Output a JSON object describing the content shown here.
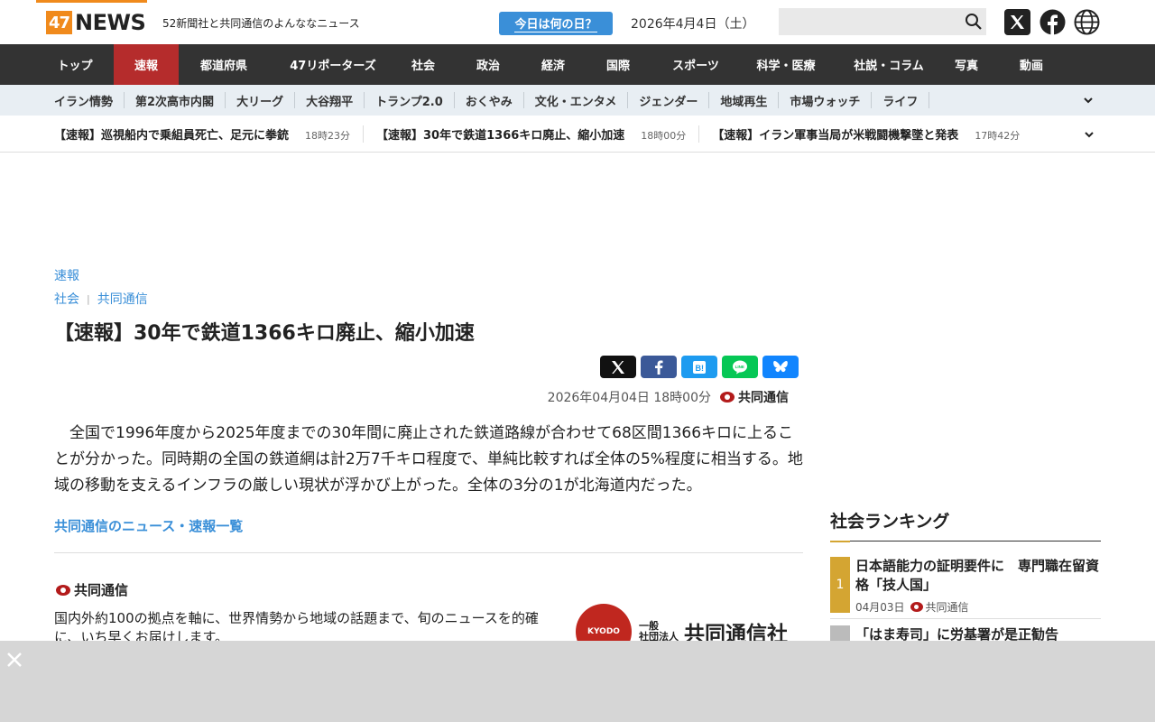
{
  "header": {
    "logo_num": "47",
    "logo_text": "NEWS",
    "tagline": "52新聞社と共同通信のよんななニュース",
    "today_button": "今日は何の日？",
    "date": "2026年4月4日（土）",
    "search_placeholder": ""
  },
  "nav": {
    "items": [
      "トップ",
      "速報",
      "都道府県",
      "47リポーターズ",
      "社会",
      "政治",
      "経済",
      "国際",
      "スポーツ",
      "科学・医療",
      "社説・コラム",
      "写真",
      "動画"
    ],
    "active": "速報"
  },
  "subnav": {
    "items": [
      "イラン情勢",
      "第2次高市内閣",
      "大リーグ",
      "大谷翔平",
      "トランプ2.0",
      "おくやみ",
      "文化・エンタメ",
      "ジェンダー",
      "地域再生",
      "市場ウォッチ",
      "ライフ"
    ]
  },
  "ticker": {
    "items": [
      {
        "title": "【速報】巡視船内で乗組員死亡、足元に拳銃",
        "time": "18時23分"
      },
      {
        "title": "【速報】30年で鉄道1366キロ廃止、縮小加速",
        "time": "18時00分"
      },
      {
        "title": "【速報】イラン軍事当局が米戦闘機撃墜と発表",
        "time": "17時42分"
      }
    ]
  },
  "article": {
    "kicker": "速報",
    "category": "社会",
    "source_link": "共同通信",
    "title": "【速報】30年で鉄道1366キロ廃止、縮小加速",
    "datetime": "2026年04月04日  18時00分",
    "source": "共同通信",
    "body": "　全国で1996年度から2025年度までの30年間に廃止された鉄道路線が合わせて68区間1366キロに上ることが分かった。同時期の全国の鉄道網は計2万7千キロ程度で、単純比較すれば全体の5%程度に相当する。地域の移動を支えるインフラの厳しい現状が浮かび上がった。全体の3分の1が北海道内だった。",
    "more_link": "共同通信のニュース・速報一覧"
  },
  "source_box": {
    "name": "共同通信",
    "description": "国内外約100の拠点を軸に、世界情勢から地域の話題まで、旬のニュースを的確に、いち早くお届けします。",
    "logo_circle": "KYODO",
    "logo_small_1": "一般",
    "logo_small_2": "社団法人",
    "logo_big": "共同通信社"
  },
  "ranking": {
    "title": "社会ランキング",
    "items": [
      {
        "rank": "1",
        "title": "日本語能力の証明要件に　専門職在留資格「技人国」",
        "date": "04月03日",
        "source": "共同通信"
      },
      {
        "rank": "2",
        "title": "「はま寿司」に労基署が是正勧告"
      }
    ]
  },
  "colors": {
    "brand_orange": "#f08a1c",
    "nav_bg": "#333333",
    "nav_active": "#b52c2c",
    "link_blue": "#3a8fd8",
    "rank_gold": "#d4a532"
  }
}
